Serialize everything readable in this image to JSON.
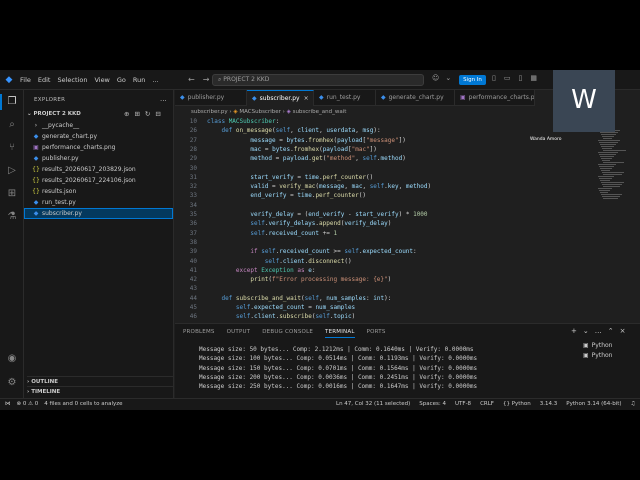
{
  "titlebar": {
    "menu": [
      "File",
      "Edit",
      "Selection",
      "View",
      "Go",
      "Run",
      "..."
    ],
    "search": "PROJECT 2 KKD",
    "signin": "Sign In"
  },
  "sidebar": {
    "title": "EXPLORER",
    "more": "...",
    "project": "PROJECT 2 KKD",
    "items": [
      {
        "label": "__pycache__",
        "icon": ">"
      },
      {
        "label": "generate_chart.py",
        "icon": "py"
      },
      {
        "label": "performance_charts.png",
        "icon": "img"
      },
      {
        "label": "publisher.py",
        "icon": "py"
      },
      {
        "label": "results_20260617_203829.json",
        "icon": "{}"
      },
      {
        "label": "results_20260617_224106.json",
        "icon": "{}"
      },
      {
        "label": "results.json",
        "icon": "{}"
      },
      {
        "label": "run_test.py",
        "icon": "py"
      },
      {
        "label": "subscriber.py",
        "icon": "py"
      }
    ],
    "outline": "OUTLINE",
    "timeline": "TIMELINE"
  },
  "tabs": [
    {
      "label": "publisher.py"
    },
    {
      "label": "subscriber.py",
      "close": "×"
    },
    {
      "label": "run_test.py"
    },
    {
      "label": "generate_chart.py"
    },
    {
      "label": "performance_charts.p"
    }
  ],
  "breadcrumb": {
    "file": "subscriber.py",
    "cls": "MACSubscriber",
    "method": "subscribe_and_wait"
  },
  "editor": {
    "lines": [
      {
        "n": "10",
        "t": "class MACSubscriber:"
      },
      {
        "n": "26",
        "t": "    def on_message(self, client, userdata, msg):"
      },
      {
        "n": "27",
        "t": "            message = bytes.fromhex(payload[\"message\"])"
      },
      {
        "n": "28",
        "t": "            mac = bytes.fromhex(payload[\"mac\"])"
      },
      {
        "n": "29",
        "t": "            method = payload.get(\"method\", self.method)"
      },
      {
        "n": "30",
        "t": ""
      },
      {
        "n": "31",
        "t": "            start_verify = time.perf_counter()"
      },
      {
        "n": "32",
        "t": "            valid = verify_mac(message, mac, self.key, method)"
      },
      {
        "n": "33",
        "t": "            end_verify = time.perf_counter()"
      },
      {
        "n": "34",
        "t": ""
      },
      {
        "n": "35",
        "t": "            verify_delay = (end_verify - start_verify) * 1000"
      },
      {
        "n": "36",
        "t": "            self.verify_delays.append(verify_delay)"
      },
      {
        "n": "37",
        "t": "            self.received_count += 1"
      },
      {
        "n": "38",
        "t": ""
      },
      {
        "n": "39",
        "t": "            if self.received_count >= self.expected_count:"
      },
      {
        "n": "40",
        "t": "                self.client.disconnect()"
      },
      {
        "n": "41",
        "t": "        except Exception as e:"
      },
      {
        "n": "42",
        "t": "            print(f\"Error processing message: {e}\")"
      },
      {
        "n": "43",
        "t": ""
      },
      {
        "n": "44",
        "t": "    def subscribe_and_wait(self, num_samples: int):"
      },
      {
        "n": "45",
        "t": "        self.expected_count = num_samples"
      },
      {
        "n": "46",
        "t": "        self.client.subscribe(self.topic)"
      }
    ]
  },
  "panel": {
    "tabs": [
      "PROBLEMS",
      "OUTPUT",
      "DEBUG CONSOLE",
      "TERMINAL",
      "PORTS"
    ],
    "active_tab": "TERMINAL",
    "terminal": [
      "Message size: 50 bytes... Comp: 2.1212ms | Comm: 0.1640ms | Verify: 0.0000ms",
      "Message size: 100 bytes... Comp: 0.0514ms | Comm: 0.1193ms | Verify: 0.0000ms",
      "Message size: 150 bytes... Comp: 0.0701ms | Comm: 0.1564ms | Verify: 0.0000ms",
      "Message size: 200 bytes... Comp: 0.0036ms | Comm: 0.2451ms | Verify: 0.0000ms",
      "Message size: 250 bytes... Comp: 0.0016ms | Comm: 0.1647ms | Verify: 0.0000ms"
    ],
    "terminals": [
      "Python",
      "Python"
    ]
  },
  "status": {
    "left": "4 files and 0 cells to analyze",
    "position": "Ln 47, Col 32 (11 selected)",
    "spaces": "Spaces: 4",
    "encoding": "UTF-8",
    "eol": "CRLF",
    "language": "Python",
    "version": "3.14.3",
    "interpreter": "Python 3.14 (64-bit)"
  },
  "participant": {
    "initial": "W",
    "name": "Wanda Amoro"
  }
}
